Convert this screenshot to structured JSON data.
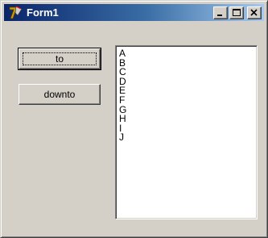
{
  "window": {
    "title": "Form1"
  },
  "title_buttons": {
    "minimize": "minimize",
    "maximize": "maximize",
    "close": "close"
  },
  "buttons": {
    "to_label": "to",
    "downto_label": "downto"
  },
  "listbox": {
    "items": [
      "A",
      "B",
      "C",
      "D",
      "E",
      "F",
      "G",
      "H",
      "I",
      "J"
    ]
  },
  "colors": {
    "face": "#d4d0c8",
    "title_start": "#0a246a",
    "title_end": "#a6caf0"
  }
}
